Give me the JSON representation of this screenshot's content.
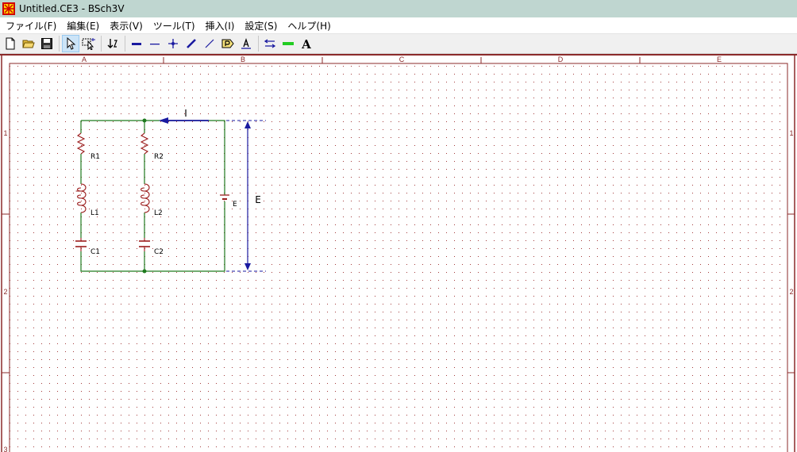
{
  "window": {
    "title": "Untitled.CE3 - BSch3V",
    "icon": "bsch-app-icon"
  },
  "menu": {
    "items": [
      "ファイル(F)",
      "編集(E)",
      "表示(V)",
      "ツール(T)",
      "挿入(I)",
      "設定(S)",
      "ヘルプ(H)"
    ]
  },
  "toolbar": {
    "buttons": [
      "new-file-icon",
      "open-folder-icon",
      "save-icon",
      "select-arrow-icon",
      "drag-select-icon",
      "swap-icon",
      "bus-icon",
      "wire-icon",
      "junction-icon",
      "diagonal-bus-icon",
      "diagonal-wire-icon",
      "tag-icon",
      "label-icon",
      "entry-icon",
      "line-icon",
      "text-icon"
    ],
    "active": "select-arrow-icon"
  },
  "sheet": {
    "columns": [
      "A",
      "B",
      "C",
      "D",
      "E"
    ],
    "rows": [
      "1",
      "2",
      "3"
    ],
    "border_color": "#8b2a2a",
    "wire_color": "#1e7a1e",
    "component_color": "#9b1c1c",
    "annotation_color": "#1a1aa0"
  },
  "schematic": {
    "components": {
      "r1": "R1",
      "r2": "R2",
      "l1": "L1",
      "l2": "L2",
      "c1": "C1",
      "c2": "C2",
      "battery": "E"
    },
    "current_label": "I",
    "voltage_label": "E"
  }
}
